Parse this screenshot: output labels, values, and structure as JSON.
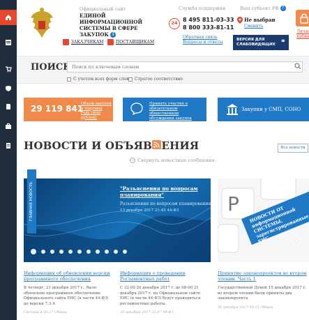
{
  "sidebar": {
    "items": [
      {
        "icon": "home-icon"
      },
      {
        "icon": "list-icon"
      },
      {
        "icon": "cart-icon"
      },
      {
        "icon": "shield-icon"
      },
      {
        "icon": "document-icon"
      },
      {
        "icon": "briefcase-icon"
      },
      {
        "icon": "registry-icon"
      }
    ]
  },
  "header": {
    "official_site": "Официальный сайт",
    "site_title": "ЕДИНОЙ ИНФОРМАЦИОННОЙ СИСТЕМЫ В СФЕРЕ ЗАКУПОК",
    "info_glyph": "i",
    "customers_link": "ЗАКАЗЧИКАМ",
    "suppliers_link": "ПОСТАВЩИКАМ",
    "support_label": "Служба поддержки",
    "support_badge": "24",
    "phone1": "8 495 811-03-33",
    "phone2": "8 800 333-81-11",
    "feedback_link": "Обратная связь Вопросы и ответы",
    "region_label": "Ваш субъект РФ",
    "region_value": "Не выбран",
    "region_change": "Сменить",
    "blind_button": "ВЕРСИЯ ДЛЯ СЛАБОВИДЯЩИХ",
    "cabinet_label": "Личный кабинет"
  },
  "search": {
    "label": "ПОИСК",
    "placeholder": "Поиск по ключевым словам",
    "option_all_forms": "С учетом всех форм слов",
    "option_strict": "Строгое соответствие"
  },
  "tiles": {
    "count": "29 119 841",
    "count_desc": "Объем закупок в текущем году (млн рублей)",
    "public_desc": "Принять участие в обязательном общественном обсуждении закупок",
    "smi_desc": "Закупки у СМП, СОНО"
  },
  "news": {
    "title": "НОВОСТИ И ОБЪЯВЛЕНИЯ",
    "all_news": "Все новости",
    "collapse": "Свернуть новостные сообщения",
    "side_tag": "ГЛАВНАЯ НОВОСТЬ",
    "slide": {
      "title": "\"Разъяснения по вопросам планирования\"",
      "subtitle": "Разъяснения по вопросам планирования",
      "meta": "13 декабря 2017 21:45   44-ФЗ"
    },
    "card_banner": "НОВОСТИ ОТ информационной СИСТЕМЫ, зарегистрированные в ЕИС",
    "items": [
      {
        "title": "Информация об обновлении версии программного обеспечения",
        "desc": "В четверг, 21 декабря 2017 г., было обновлено программное обеспечение Официального сайта ЕИС (в части 44-ФЗ) до версии 7.3.4.",
        "meta": "Сегодня в 08:27   Общая"
      },
      {
        "title": "Информация о проведении Регламентных работ",
        "desc": "С 22-00 20 декабря 2017 г. до 08-00 21 декабря 2017 г. на Официальном сайте ЕИС (в части 44-ФЗ) будут проводиться регламентные работы.",
        "meta": "20 декабря 2017 22:07   44-ФЗ"
      },
      {
        "title": "Принятие законопроектов во втором чтении. Часть 1",
        "desc": "Государственной Думой 15 декабря 2017 г. во втором чтении были приняты два законопроекта",
        "meta": "20 декабря 2017 09:33   Общая"
      }
    ]
  },
  "colors": {
    "accent": "#e8472b",
    "orange": "#f08a4b",
    "blue": "#1f79c5",
    "dark": "#1f2d3d"
  }
}
